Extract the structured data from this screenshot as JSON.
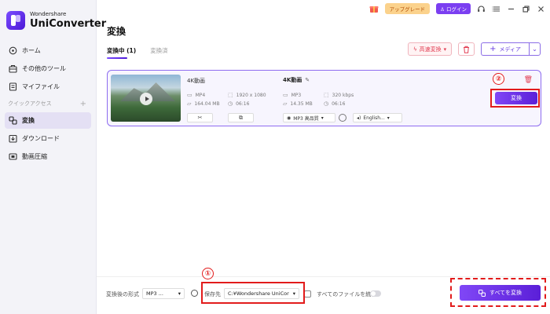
{
  "app": {
    "brand": "Wondershare",
    "product": "UniConverter"
  },
  "sidebar": {
    "items": [
      {
        "label": "ホーム",
        "icon": "home-icon"
      },
      {
        "label": "その他のツール",
        "icon": "toolbox-icon"
      },
      {
        "label": "マイファイル",
        "icon": "file-icon"
      }
    ],
    "section_label": "クイックアクセス",
    "section_add": "+",
    "quick": [
      {
        "label": "変換",
        "icon": "convert-icon",
        "active": true
      },
      {
        "label": "ダウンロード",
        "icon": "download-icon",
        "active": false
      },
      {
        "label": "動画圧縮",
        "icon": "compress-icon",
        "active": false
      }
    ]
  },
  "topbar": {
    "upgrade": "アップグレード",
    "login": "ログイン"
  },
  "page": {
    "title": "変換"
  },
  "tabs": [
    {
      "label": "変換中 (1)",
      "active": true
    },
    {
      "label": "変換済",
      "active": false
    }
  ],
  "toolbar": {
    "speed": "高速変換",
    "media": "メディア"
  },
  "file": {
    "source": {
      "name": "4K動画",
      "format": "MP4",
      "resolution": "1920 x 1080",
      "size": "164.04 MB",
      "duration": "06:16"
    },
    "target": {
      "name": "4K動画",
      "format": "MP3",
      "bitrate": "320 kbps",
      "size": "14.35 MB",
      "duration": "06:16"
    },
    "quality_select": "MP3 高品質",
    "audio_select": "English...",
    "convert": "変換"
  },
  "bottom": {
    "output_format_label": "変換後の形式",
    "output_format_value": "MP3 ...",
    "save_label": "保存先",
    "save_path": "C:¥Wondershare UniCor",
    "merge_label": "すべてのファイルを統合",
    "convert_all": "すべてを変換"
  },
  "annotations": {
    "num1": "①",
    "num2": "②"
  },
  "colors": {
    "accent": "#6a3fe0",
    "danger": "#e23d52",
    "annotation": "#e21b1b"
  }
}
